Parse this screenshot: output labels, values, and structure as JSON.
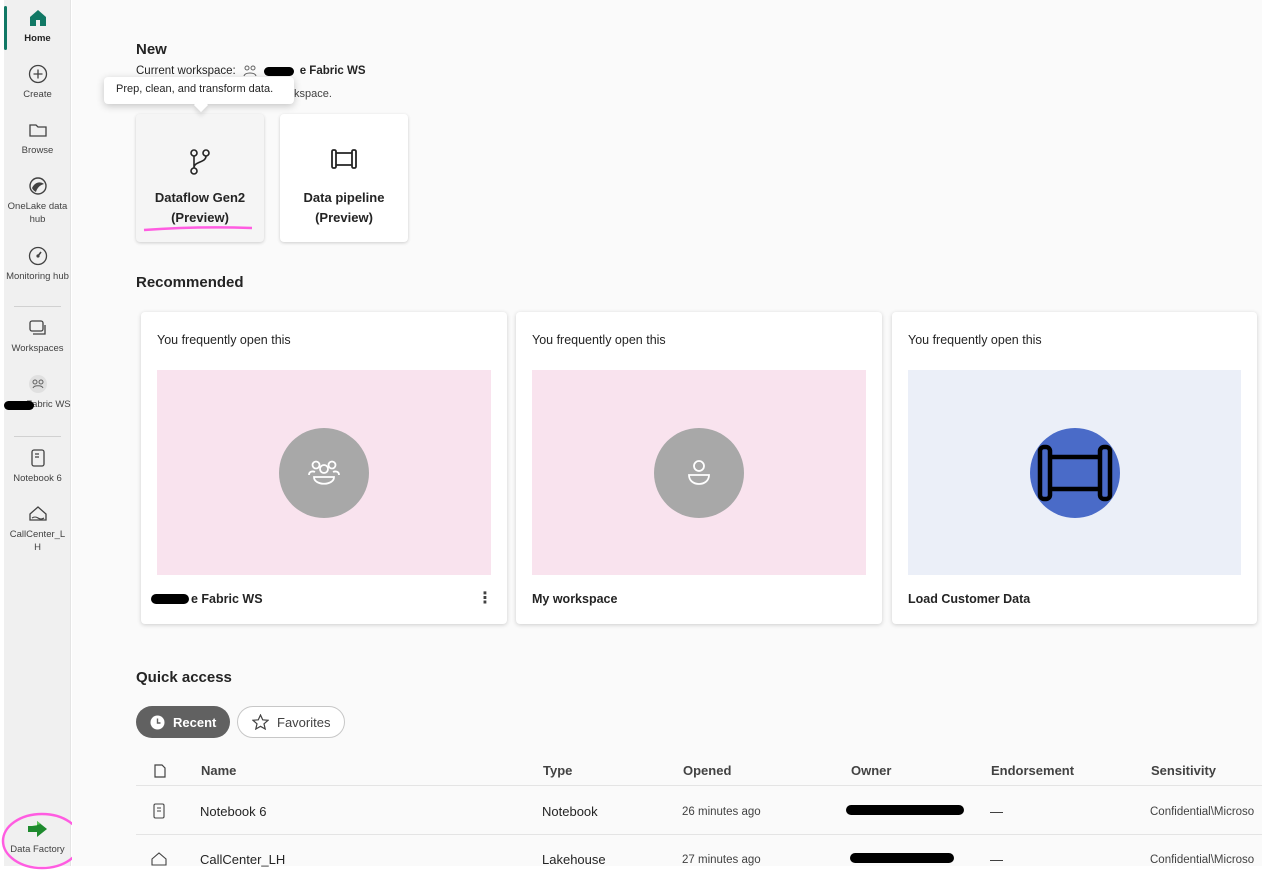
{
  "rail": {
    "items": [
      {
        "label": "Home",
        "icon": "home-icon"
      },
      {
        "label": "Create",
        "icon": "plus-circle-icon"
      },
      {
        "label": "Browse",
        "icon": "folder-icon"
      },
      {
        "label": "OneLake data hub",
        "icon": "onelake-icon"
      },
      {
        "label": "Monitoring hub",
        "icon": "monitor-icon"
      },
      {
        "label": "Workspaces",
        "icon": "workspaces-icon"
      },
      {
        "label": "e Fabric WS",
        "icon": "people-icon"
      },
      {
        "label": "Notebook 6",
        "icon": "notebook-icon"
      },
      {
        "label": "CallCenter_LH",
        "icon": "lakehouse-icon"
      }
    ],
    "footer_label": "Data Factory",
    "accent": "#117865"
  },
  "new_section": {
    "heading": "New",
    "current_workspace_label": "Current workspace:",
    "workspace_name": "e Fabric WS",
    "subtext": "kspace.",
    "tooltip": "Prep, clean, and transform data.",
    "cards": [
      {
        "line1": "Dataflow Gen2",
        "line2": "(Preview)",
        "icon": "dataflow-icon"
      },
      {
        "line1": "Data pipeline",
        "line2": "(Preview)",
        "icon": "pipeline-icon"
      }
    ]
  },
  "recommended": {
    "heading": "Recommended",
    "cards": [
      {
        "reason": "You frequently open this",
        "title": "e Fabric WS",
        "icon": "people-group-icon",
        "thumb_color": "#f9e3ee",
        "circle_color": "#a8a8a8"
      },
      {
        "reason": "You frequently open this",
        "title": "My workspace",
        "icon": "person-icon",
        "thumb_color": "#f9e3ee",
        "circle_color": "#a8a8a8"
      },
      {
        "reason": "You frequently open this",
        "title": "Load Customer Data",
        "icon": "pipeline-icon",
        "thumb_color": "#ebeff8",
        "circle_color": "#4a6bc8"
      }
    ]
  },
  "quick_access": {
    "heading": "Quick access",
    "tabs": [
      "Recent",
      "Favorites"
    ],
    "columns": [
      "Name",
      "Type",
      "Opened",
      "Owner",
      "Endorsement",
      "Sensitivity"
    ],
    "rows": [
      {
        "name": "Notebook 6",
        "type": "Notebook",
        "opened": "26 minutes ago",
        "endorsement": "—",
        "sensitivity": "Confidential\\Microso"
      },
      {
        "name": "CallCenter_LH",
        "type": "Lakehouse",
        "opened": "27 minutes ago",
        "endorsement": "—",
        "sensitivity": "Confidential\\Microso"
      }
    ]
  }
}
